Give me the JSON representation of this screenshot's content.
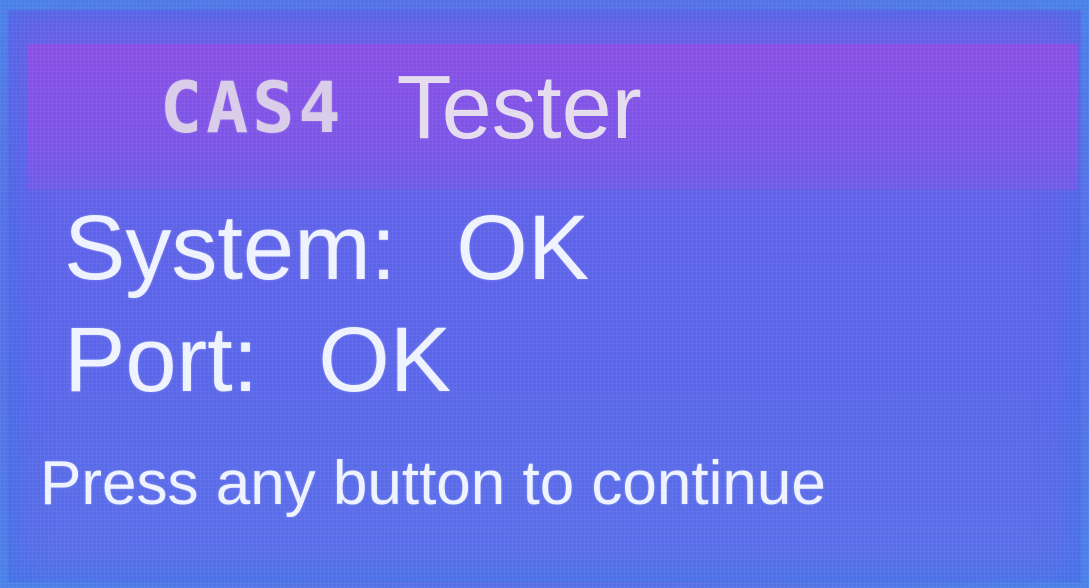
{
  "header": {
    "brand": "CAS4",
    "product": "Tester"
  },
  "status": {
    "system": {
      "label": "System:",
      "value": "OK"
    },
    "port": {
      "label": "Port:",
      "value": "OK"
    }
  },
  "prompt": "Press any button to continue",
  "colors": {
    "panel": "#5e63ea",
    "title_band": "#7c56e8",
    "text": "#eef3ff",
    "border_glow": "#3a8fe0"
  }
}
